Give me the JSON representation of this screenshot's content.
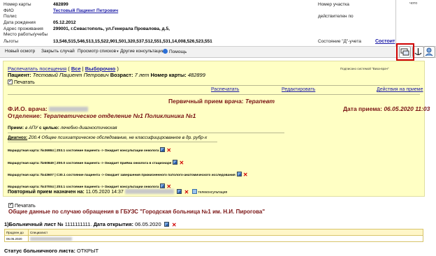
{
  "header": {
    "rows": [
      {
        "label": "Номер карты",
        "value": "482899"
      },
      {
        "label": "ФИО",
        "value": "Тестовый Пациент Петрович"
      },
      {
        "label": "Полис",
        "value": ""
      },
      {
        "label": "Дата рождения",
        "value": "05.12.2012"
      },
      {
        "label": "Адрес проживания",
        "value": "299001, г.Севастополь, ул.Генерала Провалова, д.5,"
      },
      {
        "label": "Место работы/учебы",
        "value": ""
      },
      {
        "label": "Льготы",
        "value": "13,546,515,546,513,15,522,901,501,320,537,512,551,531,14,008,526,523,551"
      }
    ],
    "right_labels": [
      "Номер участка",
      "действителен по",
      "Состояние \"Д\"-учета"
    ],
    "status_link": "Состоит",
    "corner_text": "чото"
  },
  "menu": {
    "items": [
      "Новый осмотр",
      "Закрыть случай",
      "Просмотр списков",
      "Другие консультации",
      "Помощь"
    ]
  },
  "toolbar": {
    "icons": [
      "monitor-icon",
      "anchor-icon",
      "user-search-icon",
      "extra-icon"
    ],
    "active": "monitor-icon"
  },
  "panel": {
    "print_visits": "Распечатать посещения",
    "filter_all": "Все",
    "filter_selective": "Выборочно",
    "bracket_open": "(",
    "bracket_sep": "|",
    "bracket_close": ")",
    "signature": "Подписано системой \"Виза-врач\"",
    "patient_label": "Пациент:",
    "patient_name": "Тестовый Пациент Петрович",
    "age_label": "Возраст:",
    "age_value": "7 лет",
    "card_label": "Номер карты:",
    "card_value": "482899",
    "print_check": "Печатать",
    "action_print": "Распечатать",
    "action_edit": "Редактировать",
    "action_reception": "Действия на приеме",
    "visit_title": "Первичный прием врача:",
    "visit_specialty": "Терапевт",
    "fio_label": "Ф.И.О. врача:",
    "dept_label": "Отделение:",
    "dept_value": "Терапевтическое отделение №1 Поликлиника №1",
    "date_label": "Дата приема:",
    "date_value": "06.05.2020 11:03",
    "reception_label": "Прием:",
    "reception_place": "в АПУ",
    "purpose_label": "с целью:",
    "purpose_value": "лечебно-диагностическая",
    "diagnosis_label": "Диагноз:",
    "diagnosis_value": "Z00.4 Общее психиатрическое обследование, не классифицированное в др. рубр-х",
    "routes": [
      "Маршрутная карта: №36984 | Z03.1 состояние пациента -> Ожидает консультации онколога",
      "Маршрутная карта: №50849 | Z00.0 состояние пациента -> Ожидает приёма онколога в стационаре",
      "Маршрутная карта: №43607 | C30.1 состояние пациента -> Ожидает завершения прижизненного патолого-анатомического исследования",
      "Маршрутная карта: №37004 | Z03.1 состояние пациента -> Ожидает консультации онколога"
    ],
    "repeat_label": "Повторный прием назначен на:",
    "repeat_value": "11.05.2020 14:37",
    "telecons": "телеконсультация"
  },
  "lower": {
    "print_check": "Печатать",
    "title": "Общие данные по случаю обращения в ГБУЗС \"Городская больница №1 им. Н.И. Пирогова\"",
    "sick_leave_label": "1)Больничный лист №",
    "sick_leave_number": "1111111111",
    "open_date_label": "Дата открытия:",
    "open_date_value": "06.05.2020",
    "table_headers": [
      "Продлен до",
      "Специалист"
    ],
    "table_row": [
      "06.05.2020",
      ""
    ],
    "status_label": "Статус больничного листа:",
    "status_value": "ОТКРЫТ"
  },
  "colors": {
    "panel_bg": "#ffffc4",
    "link": "#1a1aa6",
    "dark_red": "#7a1515",
    "highlight_box": "#d00000"
  }
}
